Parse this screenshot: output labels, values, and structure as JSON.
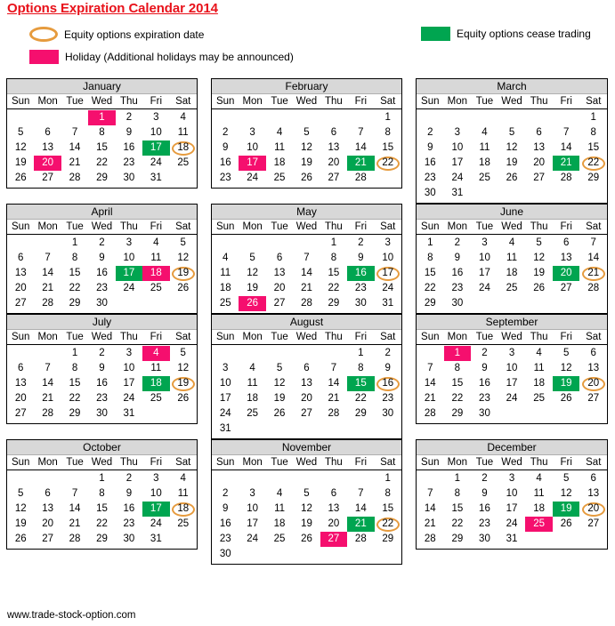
{
  "page": {
    "title": "Options Expiration Calendar 2014",
    "footer": "www.trade-stock-option.com"
  },
  "colors": {
    "title_red": "#E8111A",
    "green": "#00A550",
    "pink": "#F50F6E",
    "orange_circle": "#E69B3E",
    "month_header_gray": "#D8D8D8"
  },
  "legend": [
    {
      "icon": "orange-ellipse-outline",
      "label": "Equity options expiration date"
    },
    {
      "icon": "green-square",
      "label": "Equity options cease trading"
    },
    {
      "icon": "pink-square",
      "label": "Holiday (Additional holidays may be announced)"
    }
  ],
  "weekday_headers": [
    "Sun",
    "Mon",
    "Tue",
    "Wed",
    "Thu",
    "Fri",
    "Sat"
  ],
  "calendar_data": {
    "year": "2014",
    "months": [
      {
        "name": "January",
        "first_day_index": 3,
        "days_in_month": 31,
        "green": [
          17
        ],
        "pink": [
          1,
          20
        ],
        "circled": [
          18
        ]
      },
      {
        "name": "February",
        "first_day_index": 6,
        "days_in_month": 28,
        "green": [
          21
        ],
        "pink": [
          17
        ],
        "circled": [
          22
        ]
      },
      {
        "name": "March",
        "first_day_index": 6,
        "days_in_month": 31,
        "green": [
          21
        ],
        "pink": [],
        "circled": [
          22
        ]
      },
      {
        "name": "April",
        "first_day_index": 2,
        "days_in_month": 30,
        "green": [
          17
        ],
        "pink": [
          18
        ],
        "circled": [
          19
        ]
      },
      {
        "name": "May",
        "first_day_index": 4,
        "days_in_month": 31,
        "green": [
          16
        ],
        "pink": [
          26
        ],
        "circled": [
          17
        ]
      },
      {
        "name": "June",
        "first_day_index": 0,
        "days_in_month": 30,
        "green": [
          20
        ],
        "pink": [],
        "circled": [
          21
        ]
      },
      {
        "name": "July",
        "first_day_index": 2,
        "days_in_month": 31,
        "green": [
          18
        ],
        "pink": [
          4
        ],
        "circled": [
          19
        ]
      },
      {
        "name": "August",
        "first_day_index": 5,
        "days_in_month": 31,
        "green": [
          15
        ],
        "pink": [],
        "circled": [
          16
        ]
      },
      {
        "name": "September",
        "first_day_index": 1,
        "days_in_month": 30,
        "green": [
          19
        ],
        "pink": [
          1
        ],
        "circled": [
          20
        ]
      },
      {
        "name": "October",
        "first_day_index": 3,
        "days_in_month": 31,
        "green": [
          17
        ],
        "pink": [],
        "circled": [
          18
        ]
      },
      {
        "name": "November",
        "first_day_index": 6,
        "days_in_month": 30,
        "green": [
          21
        ],
        "pink": [
          27
        ],
        "circled": [
          22
        ]
      },
      {
        "name": "December",
        "first_day_index": 1,
        "days_in_month": 31,
        "green": [
          19
        ],
        "pink": [
          25
        ],
        "circled": [
          20
        ]
      }
    ]
  }
}
